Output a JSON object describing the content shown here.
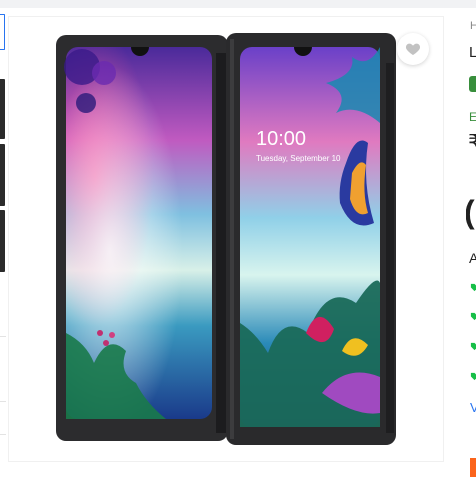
{
  "product": {
    "wishlist_icon": "heart-icon",
    "image_alt": "Dual screen smartphone",
    "lockscreen": {
      "time": "10:00",
      "date": "Tuesday, September 10"
    }
  },
  "details": {
    "breadcrumb_fragment": "H",
    "title_fragment": "L",
    "extra_fragment": "E",
    "price_fragment": "₹",
    "big_fragment": "(",
    "available_fragment": "A",
    "view_fragment": "V"
  },
  "colors": {
    "accent": "#2874f0",
    "rating_green": "#388e3c",
    "buy_orange": "#fb641b"
  }
}
